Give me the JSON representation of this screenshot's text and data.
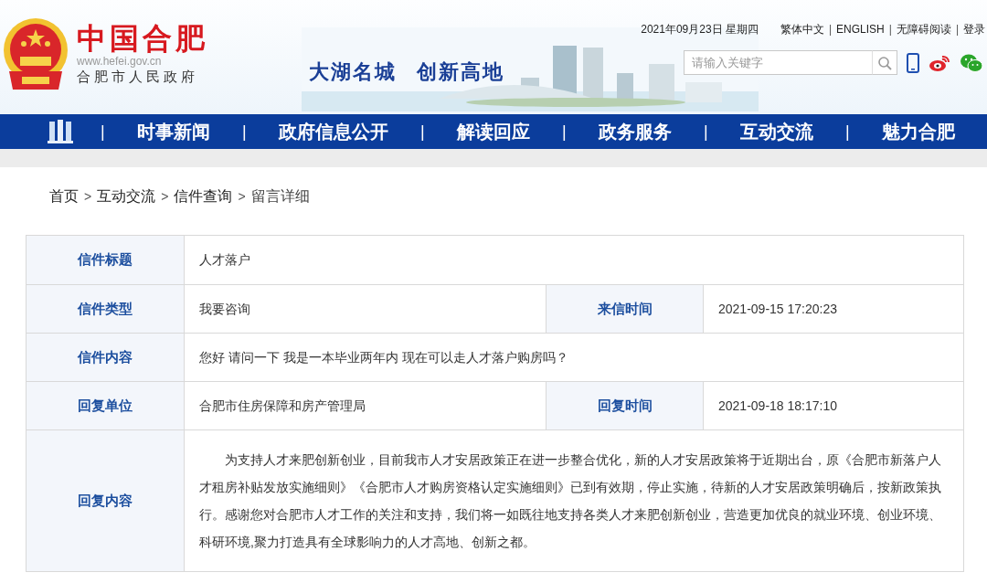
{
  "header": {
    "site_title": "中国合肥",
    "site_url": "www.hefei.gov.cn",
    "site_subtitle": "合肥市人民政府",
    "slogan": [
      "大湖名城",
      "创新高地"
    ],
    "date": "2021年09月23日 星期四",
    "top_links": [
      {
        "kind": "link",
        "text": "繁体中文"
      },
      {
        "kind": "separator",
        "text": "|"
      },
      {
        "kind": "link",
        "text": "ENGLISH"
      },
      {
        "kind": "separator",
        "text": "|"
      },
      {
        "kind": "link",
        "text": "无障碍阅读"
      },
      {
        "kind": "separator",
        "text": "|"
      },
      {
        "kind": "link",
        "text": "登录"
      }
    ],
    "search": {
      "placeholder": "请输入关键字"
    }
  },
  "nav": [
    {
      "kind": "separator",
      "text": "|"
    },
    {
      "kind": "item",
      "text": "时事新闻"
    },
    {
      "kind": "separator",
      "text": "|"
    },
    {
      "kind": "item",
      "text": "政府信息公开"
    },
    {
      "kind": "separator",
      "text": "|"
    },
    {
      "kind": "item",
      "text": "解读回应"
    },
    {
      "kind": "separator",
      "text": "|"
    },
    {
      "kind": "item",
      "text": "政务服务"
    },
    {
      "kind": "separator",
      "text": "|"
    },
    {
      "kind": "item",
      "text": "互动交流"
    },
    {
      "kind": "separator",
      "text": "|"
    },
    {
      "kind": "item",
      "text": "魅力合肥"
    }
  ],
  "breadcrumb": [
    {
      "kind": "link",
      "text": "首页"
    },
    {
      "kind": "separator",
      "text": ">"
    },
    {
      "kind": "link",
      "text": "互动交流"
    },
    {
      "kind": "separator",
      "text": ">"
    },
    {
      "kind": "link",
      "text": "信件查询"
    },
    {
      "kind": "separator",
      "text": ">"
    },
    {
      "kind": "current",
      "text": "留言详细"
    }
  ],
  "table": {
    "rows": [
      {
        "kind": "short",
        "cells": [
          {
            "kind": "label",
            "text": "信件标题"
          },
          {
            "kind": "value",
            "text": "人才落户"
          }
        ]
      },
      {
        "kind": "short",
        "cells": [
          {
            "kind": "label",
            "text": "信件类型"
          },
          {
            "kind": "value",
            "text": "我要咨询"
          },
          {
            "kind": "label",
            "text": "来信时间"
          },
          {
            "kind": "value",
            "text": "2021-09-15 17:20:23"
          }
        ]
      },
      {
        "kind": "short",
        "cells": [
          {
            "kind": "label",
            "text": "信件内容"
          },
          {
            "kind": "value",
            "text": "您好 请问一下 我是一本毕业两年内 现在可以走人才落户购房吗？"
          }
        ]
      },
      {
        "kind": "short",
        "cells": [
          {
            "kind": "label",
            "text": "回复单位"
          },
          {
            "kind": "value",
            "text": "合肥市住房保障和房产管理局"
          },
          {
            "kind": "label",
            "text": "回复时间"
          },
          {
            "kind": "value",
            "text": "2021-09-18 18:17:10"
          }
        ]
      },
      {
        "kind": "long",
        "cells": [
          {
            "kind": "label",
            "text": "回复内容"
          },
          {
            "kind": "paragraph",
            "text": "为支持人才来肥创新创业，目前我市人才安居政策正在进一步整合优化，新的人才安居政策将于近期出台，原《合肥市新落户人才租房补贴发放实施细则》《合肥市人才购房资格认定实施细则》已到有效期，停止实施，待新的人才安居政策明确后，按新政策执行。感谢您对合肥市人才工作的关注和支持，我们将一如既往地支持各类人才来肥创新创业，营造更加优良的就业环境、创业环境、科研环境,聚力打造具有全球影响力的人才高地、创新之都。"
          }
        ]
      }
    ]
  }
}
